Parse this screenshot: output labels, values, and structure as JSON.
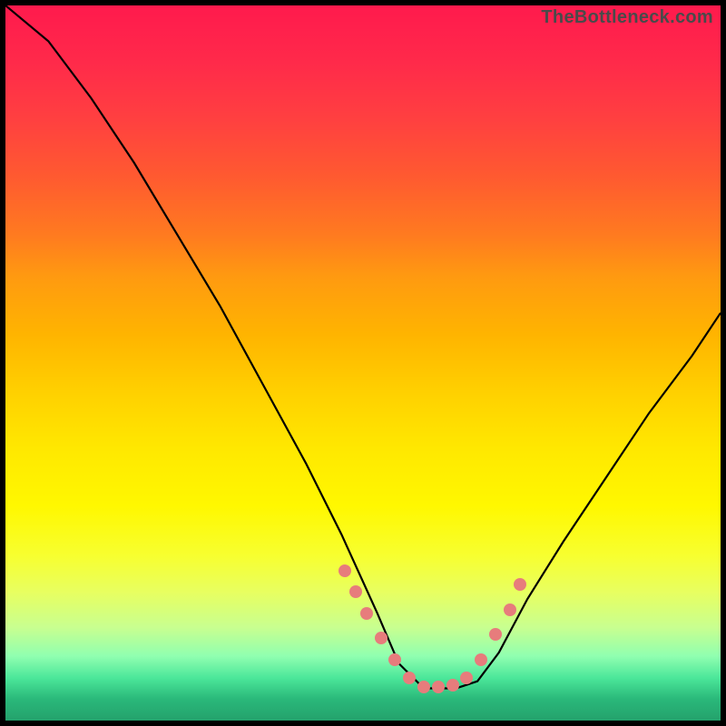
{
  "watermark": "TheBottleneck.com",
  "chart_data": {
    "type": "line",
    "title": "",
    "xlabel": "",
    "ylabel": "",
    "xlim": [
      0,
      1
    ],
    "ylim": [
      0,
      1
    ],
    "series": [
      {
        "name": "curve",
        "x": [
          0.0,
          0.06,
          0.12,
          0.18,
          0.24,
          0.3,
          0.36,
          0.42,
          0.47,
          0.52,
          0.55,
          0.585,
          0.63,
          0.66,
          0.69,
          0.73,
          0.78,
          0.84,
          0.9,
          0.96,
          1.0
        ],
        "y": [
          1.0,
          0.95,
          0.87,
          0.78,
          0.68,
          0.58,
          0.47,
          0.36,
          0.26,
          0.15,
          0.08,
          0.045,
          0.045,
          0.055,
          0.095,
          0.17,
          0.25,
          0.34,
          0.43,
          0.51,
          0.57
        ]
      }
    ],
    "markers": {
      "name": "bottleneck-points",
      "x": [
        0.475,
        0.49,
        0.505,
        0.525,
        0.545,
        0.565,
        0.585,
        0.605,
        0.625,
        0.645,
        0.665,
        0.685,
        0.705,
        0.72
      ],
      "y": [
        0.21,
        0.18,
        0.15,
        0.115,
        0.085,
        0.06,
        0.047,
        0.047,
        0.05,
        0.06,
        0.085,
        0.12,
        0.155,
        0.19
      ]
    },
    "background_gradient": [
      "#ff1a4d",
      "#ffd000",
      "#fff800",
      "#24A26C"
    ]
  }
}
